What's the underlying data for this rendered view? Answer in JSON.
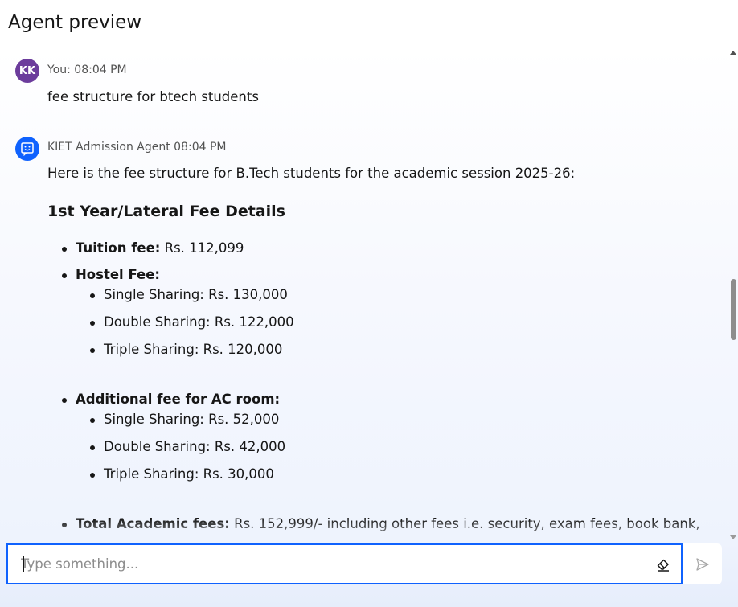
{
  "header": {
    "title": "Agent preview"
  },
  "messages": {
    "user": {
      "avatar_initials": "KK",
      "meta": "You: 08:04 PM",
      "text": "fee structure for btech students"
    },
    "bot": {
      "avatar_icon": "chat-bot-icon",
      "meta": "KIET Admission Agent 08:04 PM",
      "intro": "Here is the fee structure for B.Tech students for the academic session 2025-26:",
      "heading": "1st Year/Lateral Fee Details",
      "items": [
        {
          "label": "Tuition fee:",
          "value": " Rs. 112,099"
        },
        {
          "label": "Hostel Fee:",
          "value": "",
          "sub": [
            "Single Sharing: Rs. 130,000",
            "Double Sharing: Rs. 122,000",
            "Triple Sharing: Rs. 120,000"
          ]
        },
        {
          "label": "Additional fee for AC room:",
          "value": "",
          "sub": [
            "Single Sharing: Rs. 52,000",
            "Double Sharing: Rs. 42,000",
            "Triple Sharing: Rs. 30,000"
          ]
        },
        {
          "label": "Total Academic fees:",
          "value": " Rs. 152,999/- including other fees i.e. security, exam fees, book bank,"
        }
      ]
    }
  },
  "composer": {
    "placeholder": "Type something...",
    "clear_icon": "eraser-icon",
    "send_icon": "send-icon"
  },
  "colors": {
    "accent": "#0f62fe",
    "user_avatar": "#6c3c9c"
  }
}
